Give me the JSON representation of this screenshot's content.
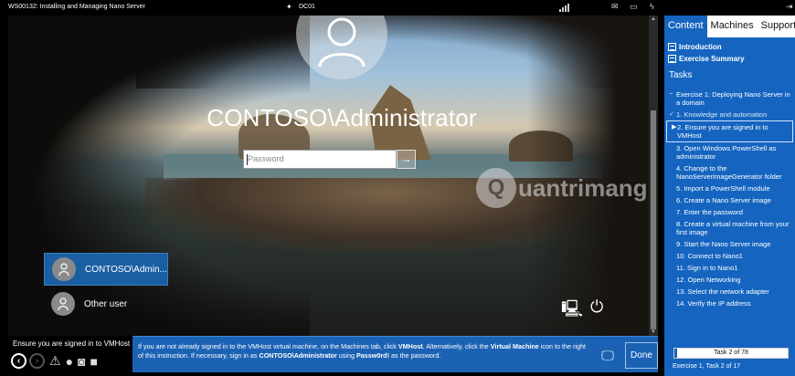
{
  "topbar": {
    "title": "WS00132: Installing and Managing Nano Server",
    "machine": "DC01"
  },
  "vm": {
    "username": "CONTOSO\\Administrator",
    "password_placeholder": "Password",
    "submit_arrow": "→",
    "watermark": "uantrimang",
    "watermark_logo": "Q",
    "users": [
      {
        "label": "CONTOSO\\Admin..."
      },
      {
        "label": "Other user"
      }
    ]
  },
  "instruction": {
    "current_step": "Ensure you are signed in to VMHost",
    "text_parts": [
      "If you are not already signed in to the VMHost virtual machine, on the Machines tab, click ",
      "VMHost",
      ". Alternatively, click the ",
      "Virtual Machine",
      " icon to the right of this instruction. If necessary, sign in as ",
      "CONTOSO\\Administrator",
      " using ",
      "Passw0rd!",
      " as the password."
    ],
    "done_label": "Done"
  },
  "panel": {
    "tabs": [
      "Content",
      "Machines",
      "Support"
    ],
    "links": [
      "Introduction",
      "Exercise Summary"
    ],
    "tasks_heading": "Tasks",
    "tasks": [
      {
        "label": "Exercise 1: Deploying Nano Server in a domain",
        "mark": "−",
        "state": "section"
      },
      {
        "label": "1. Knowledge and automation",
        "mark": "✓",
        "state": "done"
      },
      {
        "label": "2. Ensure you are signed in to VMHost",
        "mark": "▶",
        "state": "current"
      },
      {
        "label": "3. Open Windows PowerShell as administrator",
        "mark": "",
        "state": "todo"
      },
      {
        "label": "4. Change to the NanoServerImageGenerator folder",
        "mark": "",
        "state": "todo"
      },
      {
        "label": "5. Import a PowerShell module",
        "mark": "",
        "state": "todo"
      },
      {
        "label": "6. Create a Nano Server image",
        "mark": "",
        "state": "todo"
      },
      {
        "label": "7. Enter the password",
        "mark": "",
        "state": "todo"
      },
      {
        "label": "8. Create a virtual machine from your first image",
        "mark": "",
        "state": "todo"
      },
      {
        "label": "9. Start the Nano Server image",
        "mark": "",
        "state": "todo"
      },
      {
        "label": "10. Connect to Nano1",
        "mark": "",
        "state": "todo"
      },
      {
        "label": "11. Sign in to Nano1",
        "mark": "",
        "state": "todo"
      },
      {
        "label": "12. Open Networking",
        "mark": "",
        "state": "todo"
      },
      {
        "label": "13. Select the network adapter",
        "mark": "",
        "state": "todo"
      },
      {
        "label": "14. Verify the IP address",
        "mark": "",
        "state": "todo"
      }
    ],
    "progress": {
      "label": "Task 2 of 78",
      "fraction": 0.0256
    },
    "exercise_progress": "Exercise 1, Task 2 of 17"
  },
  "icons": {
    "pin": "pin-icon",
    "signal": "signal-icon",
    "mail": "mail-icon",
    "monitor": "monitor-icon",
    "power": "power-icon",
    "exit": "exit-icon",
    "network": "network-icon",
    "accessibility": "ease-of-access-icon"
  },
  "colors": {
    "accent": "#1565c0",
    "instruction_bg": "#1c62b4",
    "selected_user": "#1b5fa3"
  }
}
